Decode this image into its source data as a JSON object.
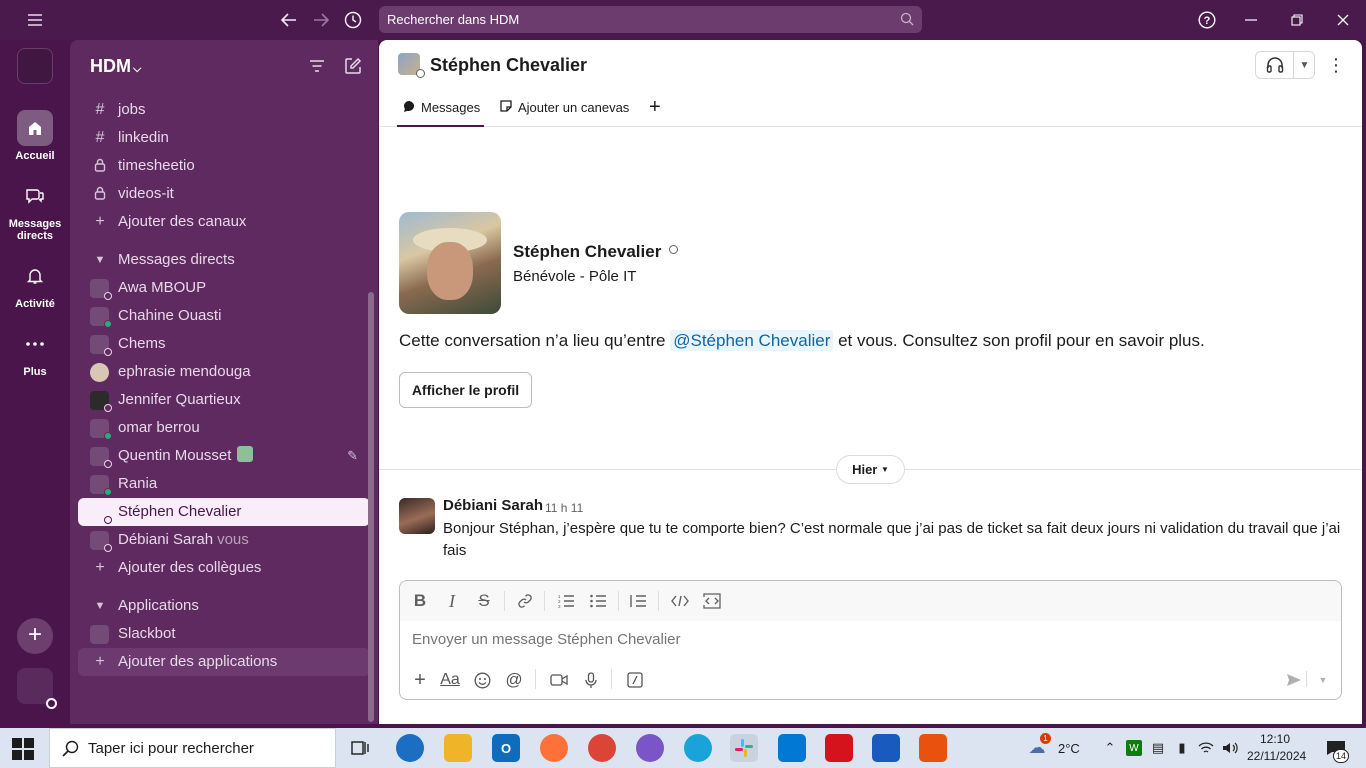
{
  "topbar": {
    "search_placeholder": "Rechercher dans HDM"
  },
  "rail": {
    "items": [
      {
        "label": "Accueil",
        "icon": "home-icon"
      },
      {
        "label": "Messages directs",
        "icon": "dm-icon"
      },
      {
        "label": "Activité",
        "icon": "bell-icon"
      },
      {
        "label": "Plus",
        "icon": "more-icon"
      }
    ]
  },
  "sidebar": {
    "workspace": "HDM",
    "channels": [
      {
        "label": "jobs",
        "icon": "hash-icon"
      },
      {
        "label": "linkedin",
        "icon": "hash-icon"
      },
      {
        "label": "timesheetio",
        "icon": "lock-icon"
      },
      {
        "label": "videos-it",
        "icon": "lock-icon"
      }
    ],
    "add_channels": "Ajouter des canaux",
    "dm_section": "Messages directs",
    "dms": [
      {
        "label": "Awa MBOUP"
      },
      {
        "label": "Chahine Ouasti"
      },
      {
        "label": "Chems"
      },
      {
        "label": "ephrasie mendouga"
      },
      {
        "label": "Jennifer Quartieux"
      },
      {
        "label": "omar berrou"
      },
      {
        "label": "Quentin Mousset"
      },
      {
        "label": "Rania"
      },
      {
        "label": "Stéphen Chevalier"
      },
      {
        "label": "Débiani Sarah",
        "suffix": "vous"
      }
    ],
    "add_colleagues": "Ajouter des collègues",
    "apps_section": "Applications",
    "apps": [
      {
        "label": "Slackbot"
      }
    ],
    "add_apps": "Ajouter des applications"
  },
  "header": {
    "name": "Stéphen Chevalier",
    "tabs": [
      {
        "label": "Messages"
      },
      {
        "label": "Ajouter un canevas"
      }
    ]
  },
  "intro": {
    "name": "Stéphen Chevalier",
    "title": "Bénévole - Pôle IT",
    "text_before": "Cette conversation n’a lieu qu’entre ",
    "mention": "@Stéphen Chevalier",
    "text_after": " et vous. Consultez son profil pour en savoir plus.",
    "profile_button": "Afficher le profil"
  },
  "divider": {
    "label": "Hier"
  },
  "message": {
    "author": "Débiani Sarah",
    "time": "11 h 11",
    "text": "Bonjour Stéphan, j’espère que tu te comporte bien? C’est normale que j’ai pas de ticket sa fait deux jours ni validation du travail que j’ai fais"
  },
  "composer": {
    "placeholder": "Envoyer un message Stéphen Chevalier",
    "font_button": "Aa"
  },
  "taskbar": {
    "search_placeholder": "Taper ici pour rechercher",
    "weather_temp": "2°C",
    "weather_badge": "1",
    "time": "12:10",
    "date": "22/11/2024",
    "notif_count": "14"
  },
  "colors": {
    "aubergine": "#4a154b",
    "sidebar": "#5e2a60",
    "online": "#2bac76",
    "mention": "#1264a3"
  }
}
